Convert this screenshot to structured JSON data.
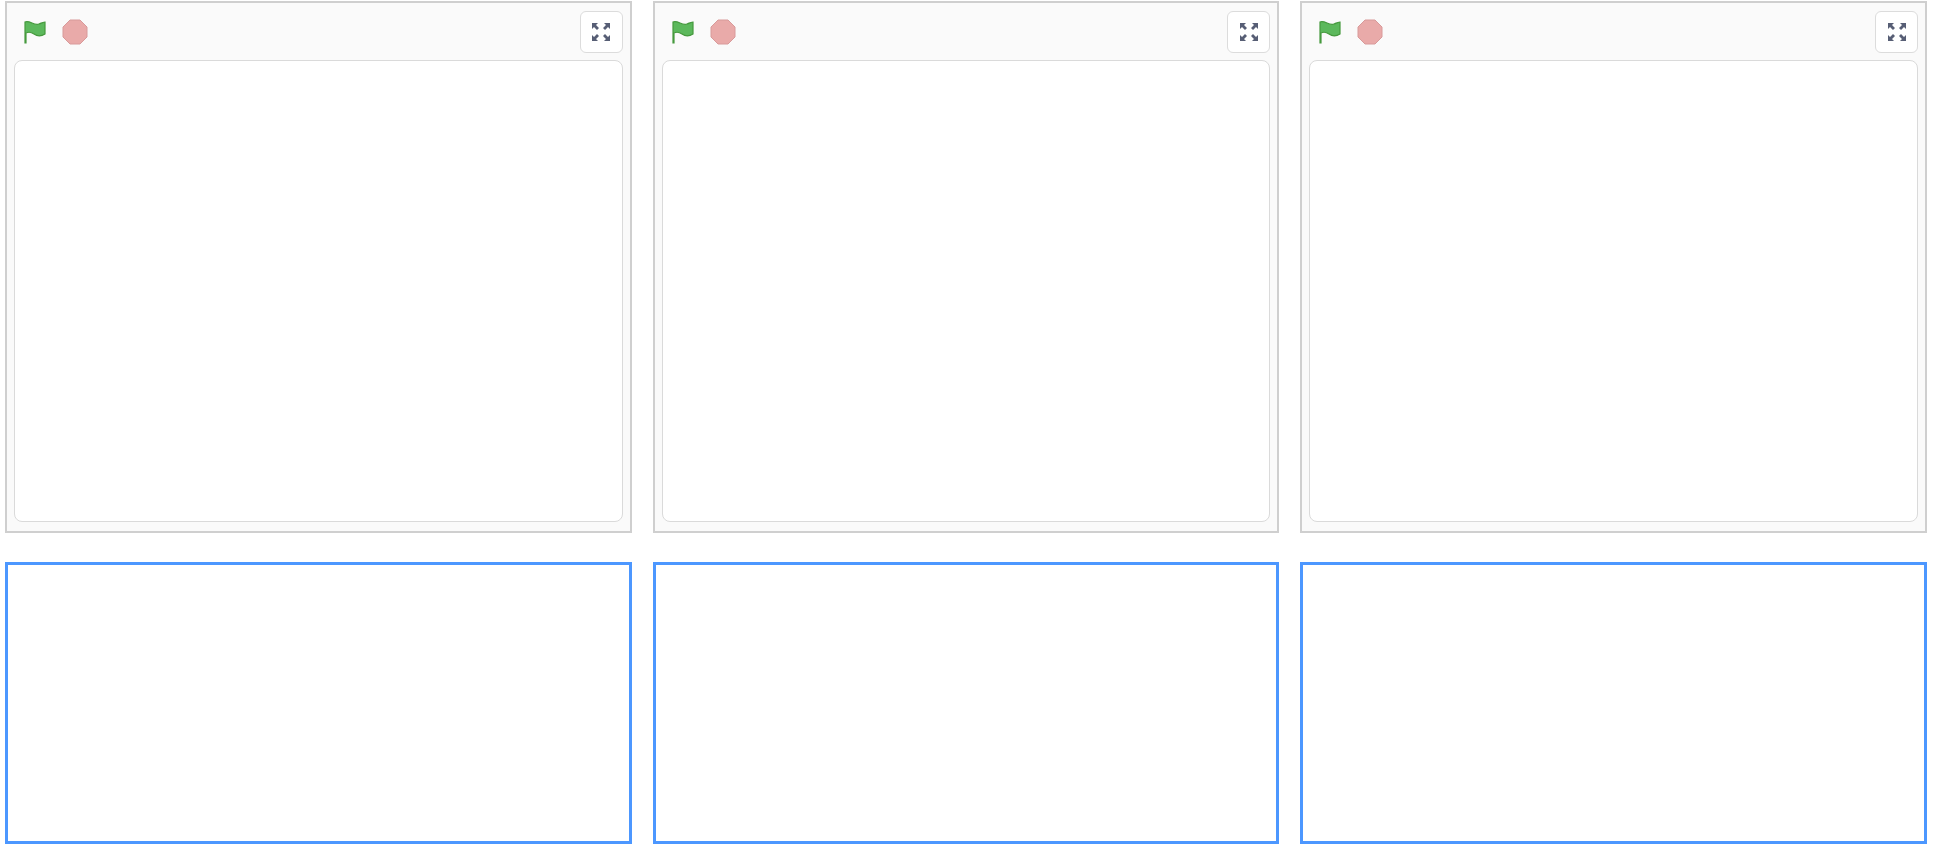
{
  "panels": [
    {
      "running": false,
      "focused": true
    },
    {
      "running": false,
      "focused": true
    },
    {
      "running": false,
      "focused": true
    }
  ]
}
